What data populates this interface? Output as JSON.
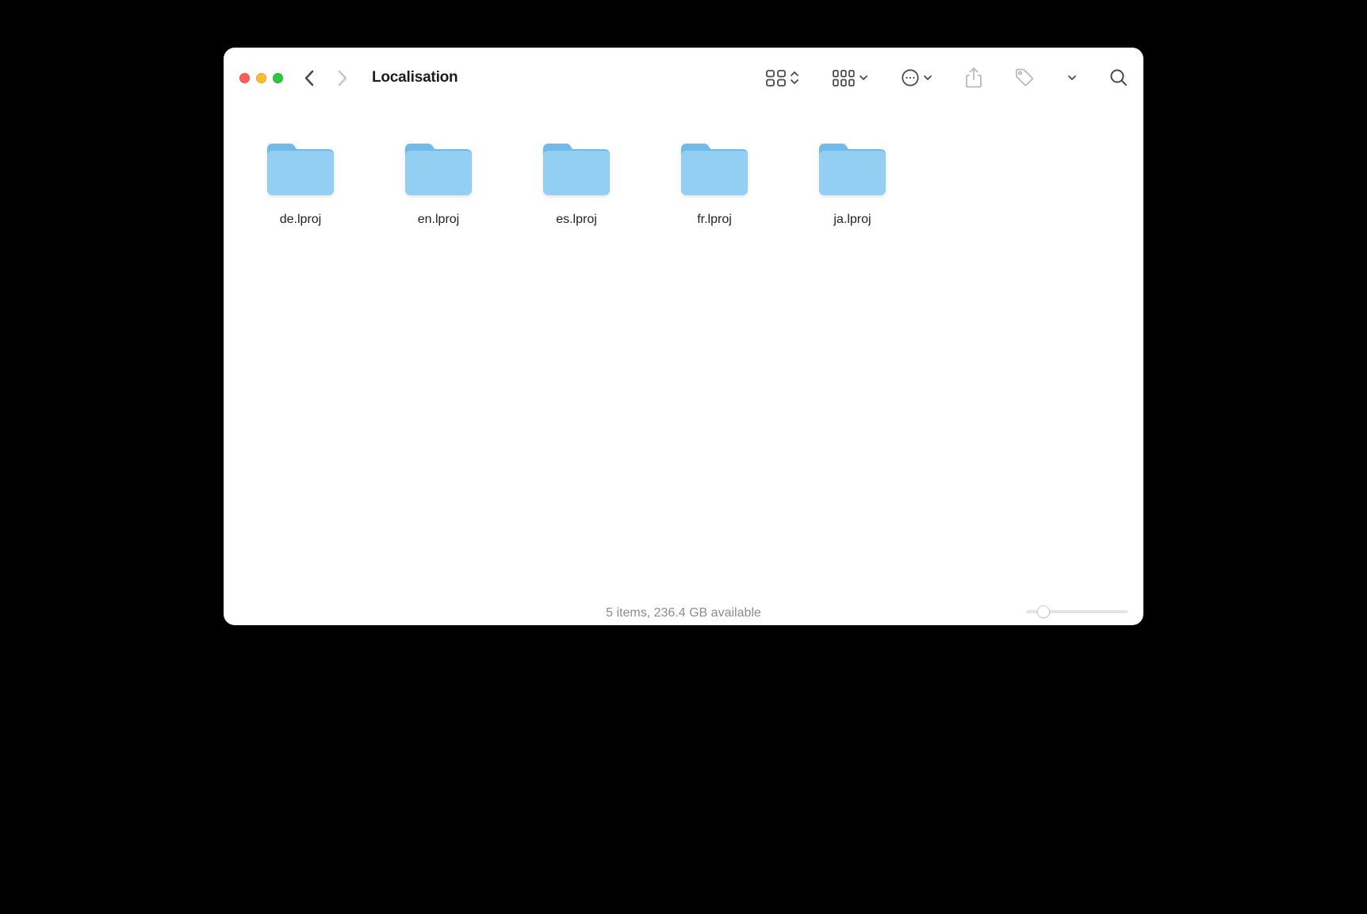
{
  "window": {
    "title": "Localisation"
  },
  "items": [
    {
      "name": "de.lproj"
    },
    {
      "name": "en.lproj"
    },
    {
      "name": "es.lproj"
    },
    {
      "name": "fr.lproj"
    },
    {
      "name": "ja.lproj"
    }
  ],
  "status": {
    "text": "5 items, 236.4 GB available"
  }
}
